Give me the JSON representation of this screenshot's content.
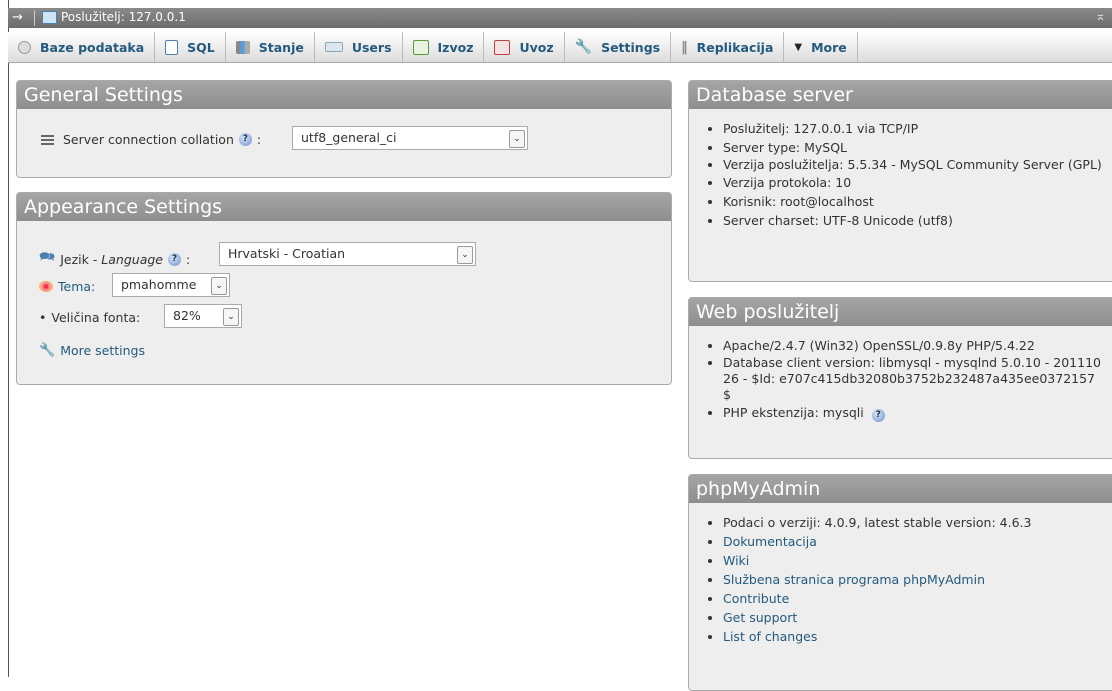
{
  "topbar": {
    "arrow": "→",
    "server_label": "Poslužitelj: 127.0.0.1",
    "collapse": "⌅"
  },
  "tabs": [
    {
      "label": "Baze podataka",
      "icon": "database-icon"
    },
    {
      "label": "SQL",
      "icon": "sql-icon"
    },
    {
      "label": "Stanje",
      "icon": "status-icon"
    },
    {
      "label": "Users",
      "icon": "users-icon"
    },
    {
      "label": "Izvoz",
      "icon": "export-icon"
    },
    {
      "label": "Uvoz",
      "icon": "import-icon"
    },
    {
      "label": "Settings",
      "icon": "wrench-icon"
    },
    {
      "label": "Replikacija",
      "icon": "replication-icon"
    },
    {
      "label": "More",
      "icon": "caret-down-icon"
    }
  ],
  "general": {
    "title": "General Settings",
    "collation_label": "Server connection collation",
    "collation_value": "utf8_general_ci"
  },
  "appearance": {
    "title": "Appearance Settings",
    "lang_label": "Jezik - ",
    "lang_label_italic": "Language",
    "lang_value": "Hrvatski - Croatian",
    "theme_label": "Tema:",
    "theme_value": "pmahomme",
    "font_label": "Veličina fonta:",
    "font_value": "82%",
    "more_settings": "More settings"
  },
  "db_server": {
    "title": "Database server",
    "items": [
      "Poslužitelj: 127.0.0.1 via TCP/IP",
      "Server type: MySQL",
      "Verzija poslužitelja: 5.5.34 - MySQL Community Server (GPL)",
      "Verzija protokola: 10",
      "Korisnik: root@localhost",
      "Server charset: UTF-8 Unicode (utf8)"
    ]
  },
  "web_server": {
    "title": "Web poslužitelj",
    "items": [
      "Apache/2.4.7 (Win32) OpenSSL/0.9.8y PHP/5.4.22",
      "Database client version: libmysql - mysqlnd 5.0.10 - 20111026 - $Id: e707c415db32080b3752b232487a435ee0372157 $",
      "PHP ekstenzija: mysqli"
    ]
  },
  "pma": {
    "title": "phpMyAdmin",
    "version": "Podaci o verziji: 4.0.9, latest stable version: 4.6.3",
    "links": [
      "Dokumentacija",
      "Wiki",
      "Službena stranica programa phpMyAdmin",
      "Contribute",
      "Get support",
      "List of changes"
    ]
  },
  "colors": {
    "link": "#235a81",
    "panel_header": "#999999",
    "panel_bg": "#eeeeee"
  }
}
